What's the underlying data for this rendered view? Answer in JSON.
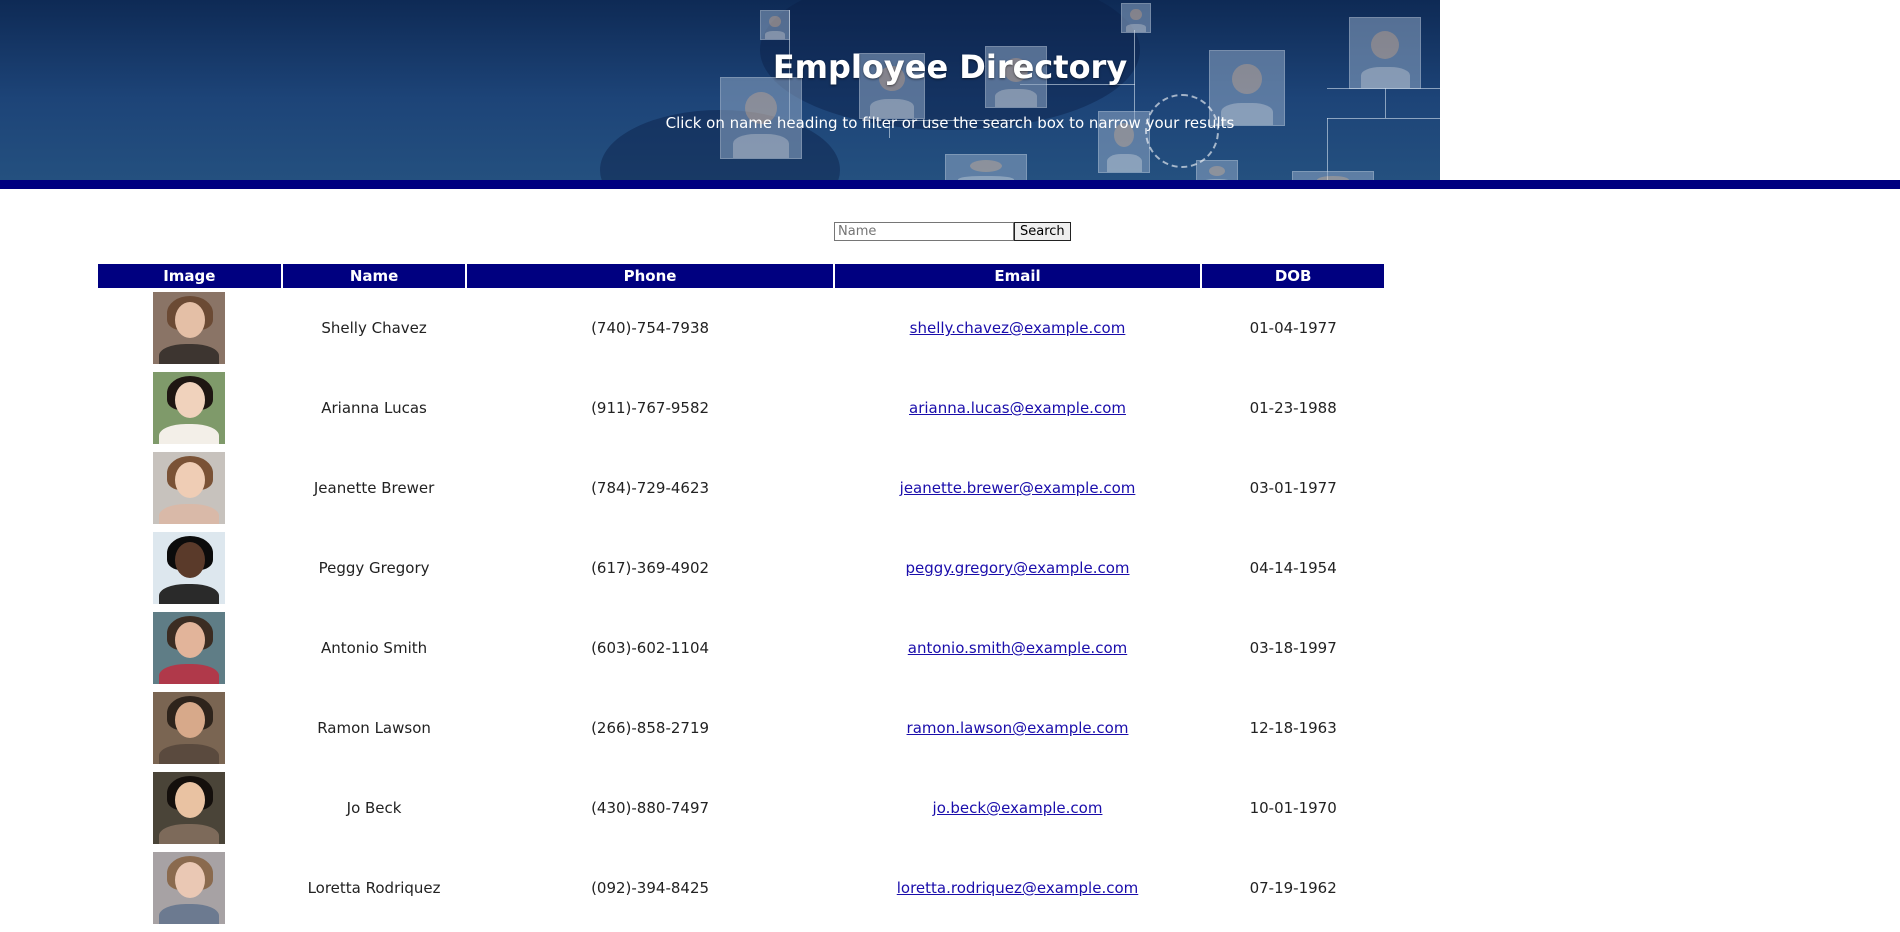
{
  "header": {
    "title": "Employee Directory",
    "subtitle": "Click on name heading to filter or use the search box to narrow your results"
  },
  "search": {
    "placeholder": "Name",
    "value": "",
    "button_label": "Search"
  },
  "table": {
    "columns": [
      "Image",
      "Name",
      "Phone",
      "Email",
      "DOB"
    ],
    "rows": [
      {
        "name": "Shelly Chavez",
        "phone": "(740)-754-7938",
        "email": "shelly.chavez@example.com",
        "dob": "01-04-1977",
        "photo": {
          "bg": "#8a7466",
          "hair": "#6b4a34",
          "face": "#e4bfa6",
          "torso": "#3d3530"
        }
      },
      {
        "name": "Arianna Lucas",
        "phone": "(911)-767-9582",
        "email": "arianna.lucas@example.com",
        "dob": "01-23-1988",
        "photo": {
          "bg": "#7f9a6a",
          "hair": "#1e1612",
          "face": "#f0d2bc",
          "torso": "#f3efe8"
        }
      },
      {
        "name": "Jeanette Brewer",
        "phone": "(784)-729-4623",
        "email": "jeanette.brewer@example.com",
        "dob": "03-01-1977",
        "photo": {
          "bg": "#c7c2bd",
          "hair": "#7a5236",
          "face": "#efcdb5",
          "torso": "#d9b9a8"
        }
      },
      {
        "name": "Peggy Gregory",
        "phone": "(617)-369-4902",
        "email": "peggy.gregory@example.com",
        "dob": "04-14-1954",
        "photo": {
          "bg": "#dde7ee",
          "hair": "#0b0b0b",
          "face": "#5a3a2a",
          "torso": "#2a2a2a"
        }
      },
      {
        "name": "Antonio Smith",
        "phone": "(603)-602-1104",
        "email": "antonio.smith@example.com",
        "dob": "03-18-1997",
        "photo": {
          "bg": "#5f7d86",
          "hair": "#3b2c22",
          "face": "#e2b49a",
          "torso": "#b0394a"
        }
      },
      {
        "name": "Ramon Lawson",
        "phone": "(266)-858-2719",
        "email": "ramon.lawson@example.com",
        "dob": "12-18-1963",
        "photo": {
          "bg": "#7a6552",
          "hair": "#2e241c",
          "face": "#d7a98a",
          "torso": "#5a4a3e"
        }
      },
      {
        "name": "Jo Beck",
        "phone": "(430)-880-7497",
        "email": "jo.beck@example.com",
        "dob": "10-01-1970",
        "photo": {
          "bg": "#4a4438",
          "hair": "#140f0c",
          "face": "#e9c2a2",
          "torso": "#7d6a5a"
        }
      },
      {
        "name": "Loretta Rodriquez",
        "phone": "(092)-394-8425",
        "email": "loretta.rodriquez@example.com",
        "dob": "07-19-1962",
        "photo": {
          "bg": "#a7a2a4",
          "hair": "#8a6a4e",
          "face": "#eac8b4",
          "torso": "#6c7a90"
        }
      }
    ]
  }
}
